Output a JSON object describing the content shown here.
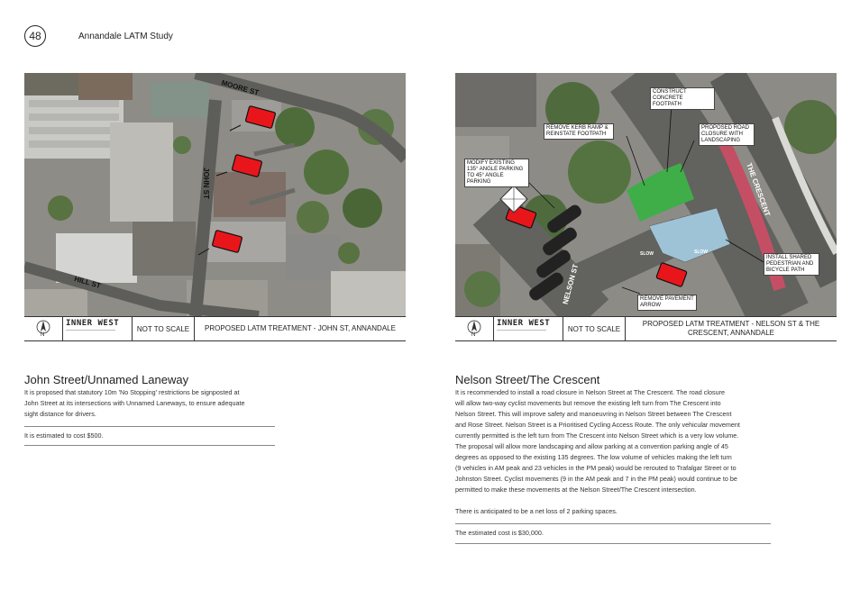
{
  "header": {
    "page_number": "48",
    "document_title": "Annandale LATM Study"
  },
  "left": {
    "map": {
      "streets": [
        "MOORE ST",
        "JOHN ST",
        "HILL ST"
      ]
    },
    "titleblock": {
      "north_label": "N",
      "logo": "INNER WEST",
      "scale": "NOT TO SCALE",
      "description": "PROPOSED LATM TREATMENT - JOHN ST, ANNANDALE"
    },
    "section_title": "John Street/Unnamed Laneway",
    "body_lines": [
      "It is proposed that statutory 10m 'No Stopping' restrictions be signposted at",
      "John Street at its intersections with Unnamed Laneways, to ensure adequate",
      "sight distance for drivers."
    ],
    "cost": "It is estimated to cost $500."
  },
  "right": {
    "map": {
      "streets": [
        "NELSON ST",
        "THE CRESCENT"
      ],
      "callouts": {
        "construct": "CONSTRUCT CONCRETE FOOTPATH",
        "kerb": "REMOVE KERB RAMP & REINSTATE FOOTPATH",
        "closure": "PROPOSED ROAD CLOSURE WITH LANDSCAPING",
        "angle": "MODIFY EXISTING 135° ANGLE PARKING TO 45° ANGLE PARKING",
        "shared": "INSTALL SHARED PEDESTRIAN AND BICYCLE PATH",
        "arrow": "REMOVE PAVEMENT ARROW"
      },
      "slow": "SLOW"
    },
    "titleblock": {
      "north_label": "N",
      "logo": "INNER WEST",
      "scale": "NOT TO SCALE",
      "description": "PROPOSED LATM TREATMENT - NELSON ST & THE CRESCENT, ANNANDALE"
    },
    "section_title": "Nelson Street/The Crescent",
    "body_lines": [
      "It is recommended to install a road closure in Nelson Street at The Crescent. The road closure",
      "will allow two-way cyclist movements but remove the existing left turn from The Crescent into",
      "Nelson Street. This will improve safety and manoeuvring in Nelson Street between The Crescent",
      "and Rose Street. Nelson Street is a Prioritised Cycling Access Route. The only vehicular movement",
      "currently permitted is the left turn from The Crescent into Nelson Street which is a very low volume.",
      "The proposal will allow more landscaping and allow parking at a convention parking angle of 45",
      "degrees as opposed to the existing 135 degrees.  The low volume of vehicles making the left turn",
      "(9 vehicles in AM peak and 23 vehicles in the PM peak) would be rerouted to Trafalgar Street or to",
      "Johnston Street. Cyclist movements (9 in the AM peak and 7 in the PM peak) would continue to be",
      "permitted to make these movements at the Nelson Street/The Crescent intersection."
    ],
    "parking_note": "There is anticipated to be a net loss of 2 parking spaces.",
    "cost": "The estimated cost is $30,000."
  },
  "colors": {
    "marker_red": "#e8161b",
    "landscape_green": "#3fae49",
    "pave_blue": "#9fc3d6"
  }
}
